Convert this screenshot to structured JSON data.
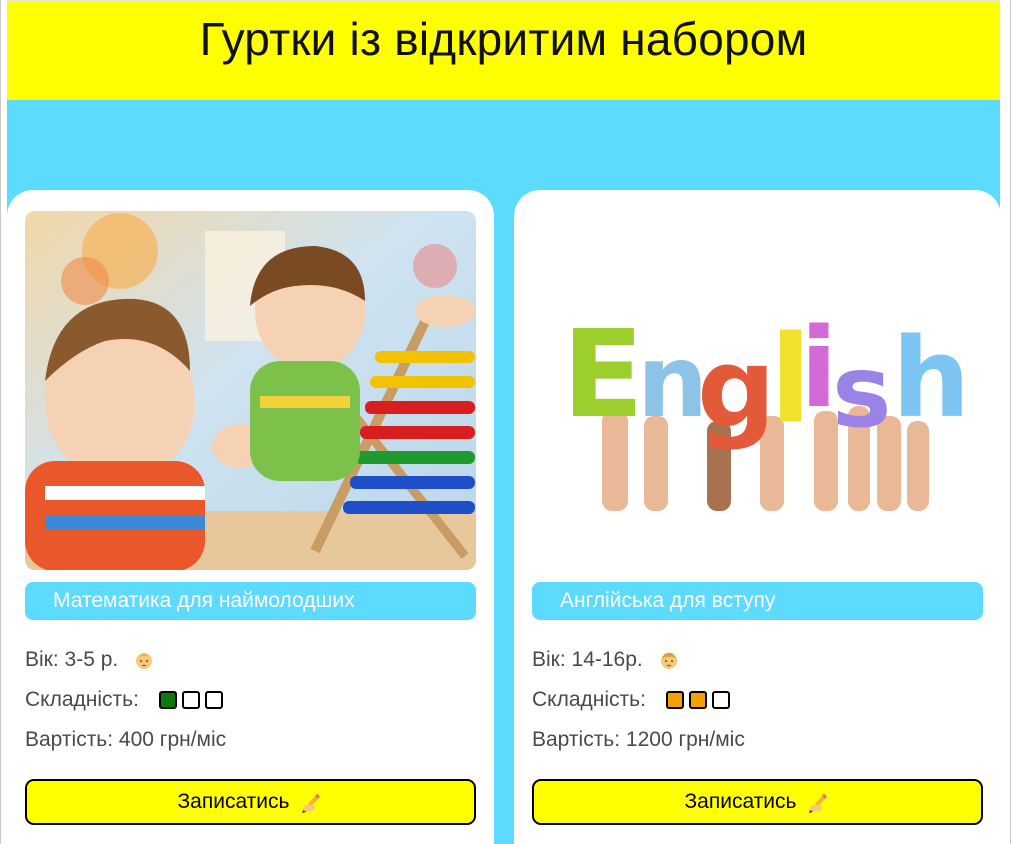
{
  "page": {
    "title": "Гуртки із відкритим набором"
  },
  "colors": {
    "header": "#ffff00",
    "band": "#5cdbff",
    "pill": "#5cdbff",
    "button": "#ffff00"
  },
  "cards": [
    {
      "photo_icon": "children-abacus-photo",
      "title": "Математика для наймолодших",
      "age_label": "Вік: 3-5 р.",
      "age_icon": "baby-face-emoji",
      "difficulty_label": "Складність:",
      "difficulty_level": 1,
      "difficulty_max": 3,
      "difficulty_color": "#0a7a0a",
      "price_label": "Вартість: 400 грн/міс",
      "button_label": "Записатись",
      "button_icon": "writing-hand-emoji"
    },
    {
      "photo_icon": "english-letters-hands-photo",
      "title": "Англійська для вступу",
      "age_label": "Вік: 14-16р.",
      "age_icon": "child-face-emoji",
      "difficulty_label": "Складність:",
      "difficulty_level": 2,
      "difficulty_max": 3,
      "difficulty_color": "#f4a000",
      "price_label": "Вартість: 1200 грн/міс",
      "button_label": "Записатись",
      "button_icon": "writing-hand-emoji"
    }
  ]
}
